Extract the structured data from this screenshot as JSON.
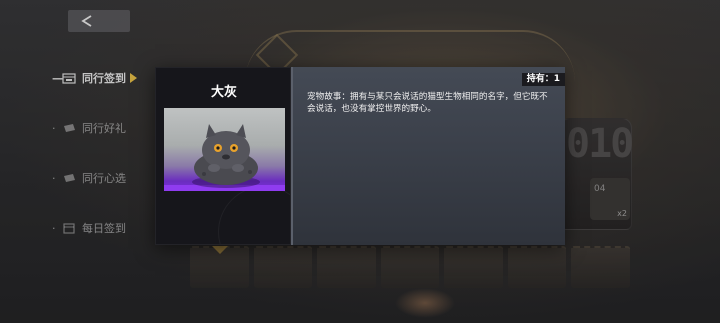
{
  "nav": {
    "back_icon": "chevron-left-icon",
    "items": [
      {
        "label": "同行签到",
        "icon": "calendar-icon",
        "active": true
      },
      {
        "label": "同行好礼",
        "icon": "ticket-icon",
        "active": false
      },
      {
        "label": "同行心选",
        "icon": "ticket-icon",
        "active": false
      },
      {
        "label": "每日签到",
        "icon": "calendar-icon",
        "active": false
      }
    ],
    "dash": "—"
  },
  "popup": {
    "pet_name": "大灰",
    "owned_label": "持有：1",
    "story": "宠物故事：拥有与某只会说话的猫型生物相同的名字，但它既不会说话，也没有掌控世界的野心。"
  },
  "background": {
    "card_digits": "010",
    "small_card_label": "04",
    "small_card_count": "x2"
  },
  "colors": {
    "accent_arrow": "#f2c94c",
    "rarity_purple": "#7d2fe0",
    "popup_left_bg": "#16161b",
    "popup_right_bg": "#3b404a"
  }
}
